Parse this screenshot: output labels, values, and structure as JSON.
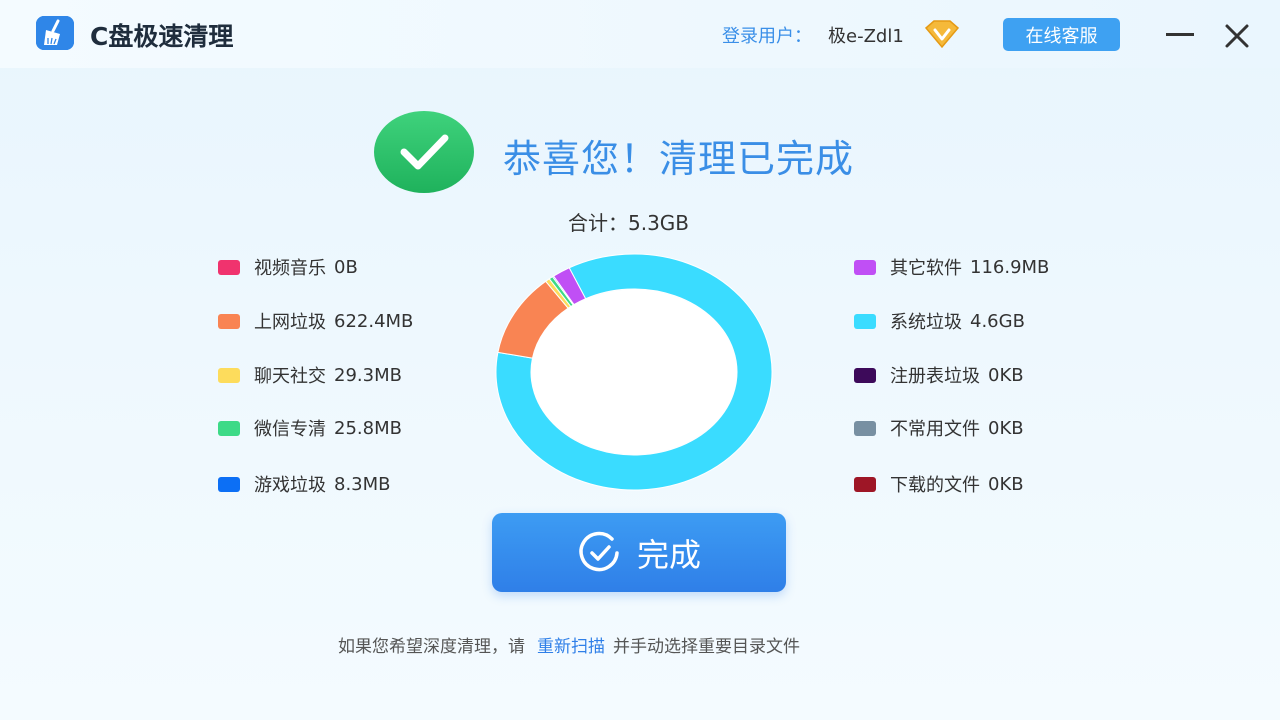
{
  "app": {
    "title": "C盘极速清理",
    "user_label": "登录用户：",
    "user_name": "极e-Zdl1",
    "service_label": "在线客服"
  },
  "result": {
    "headline": "恭喜您！清理已完成",
    "total": "合计：5.3GB"
  },
  "categories_left": [
    {
      "label": "视频音乐",
      "size": "0B",
      "color": "#f0336e"
    },
    {
      "label": "上网垃圾",
      "size": "622.4MB",
      "color": "#f98453"
    },
    {
      "label": "聊天社交",
      "size": "29.3MB",
      "color": "#fddc5c"
    },
    {
      "label": "微信专清",
      "size": "25.8MB",
      "color": "#3dda87"
    },
    {
      "label": "游戏垃圾",
      "size": "8.3MB",
      "color": "#0c6ff5"
    }
  ],
  "categories_right": [
    {
      "label": "其它软件",
      "size": "116.9MB",
      "color": "#c04ff5"
    },
    {
      "label": "系统垃圾",
      "size": "4.6GB",
      "color": "#3adcff"
    },
    {
      "label": "注册表垃圾",
      "size": "0KB",
      "color": "#3d0a5a"
    },
    {
      "label": "不常用文件",
      "size": "0KB",
      "color": "#7890a2"
    },
    {
      "label": "下载的文件",
      "size": "0KB",
      "color": "#9e1626"
    }
  ],
  "chart_data": {
    "type": "pie",
    "labels": [
      "视频音乐",
      "上网垃圾",
      "聊天社交",
      "微信专清",
      "游戏垃圾",
      "其它软件",
      "系统垃圾",
      "注册表垃圾",
      "不常用文件",
      "下载的文件"
    ],
    "values_mb": [
      0,
      622.4,
      29.3,
      25.8,
      8.3,
      116.9,
      4710.4,
      0,
      0,
      0
    ],
    "colors": [
      "#f0336e",
      "#f98453",
      "#fddc5c",
      "#3dda87",
      "#0c6ff5",
      "#c04ff5",
      "#3adcff",
      "#3d0a5a",
      "#7890a2",
      "#9e1626"
    ],
    "donut": true
  },
  "actions": {
    "done_label": "完成"
  },
  "footer": {
    "prefix": "如果您希望深度清理，请",
    "link": "重新扫描",
    "suffix": "并手动选择重要目录文件"
  },
  "colors": {
    "accent": "#3a8ee6",
    "success": "#2bc36a"
  }
}
